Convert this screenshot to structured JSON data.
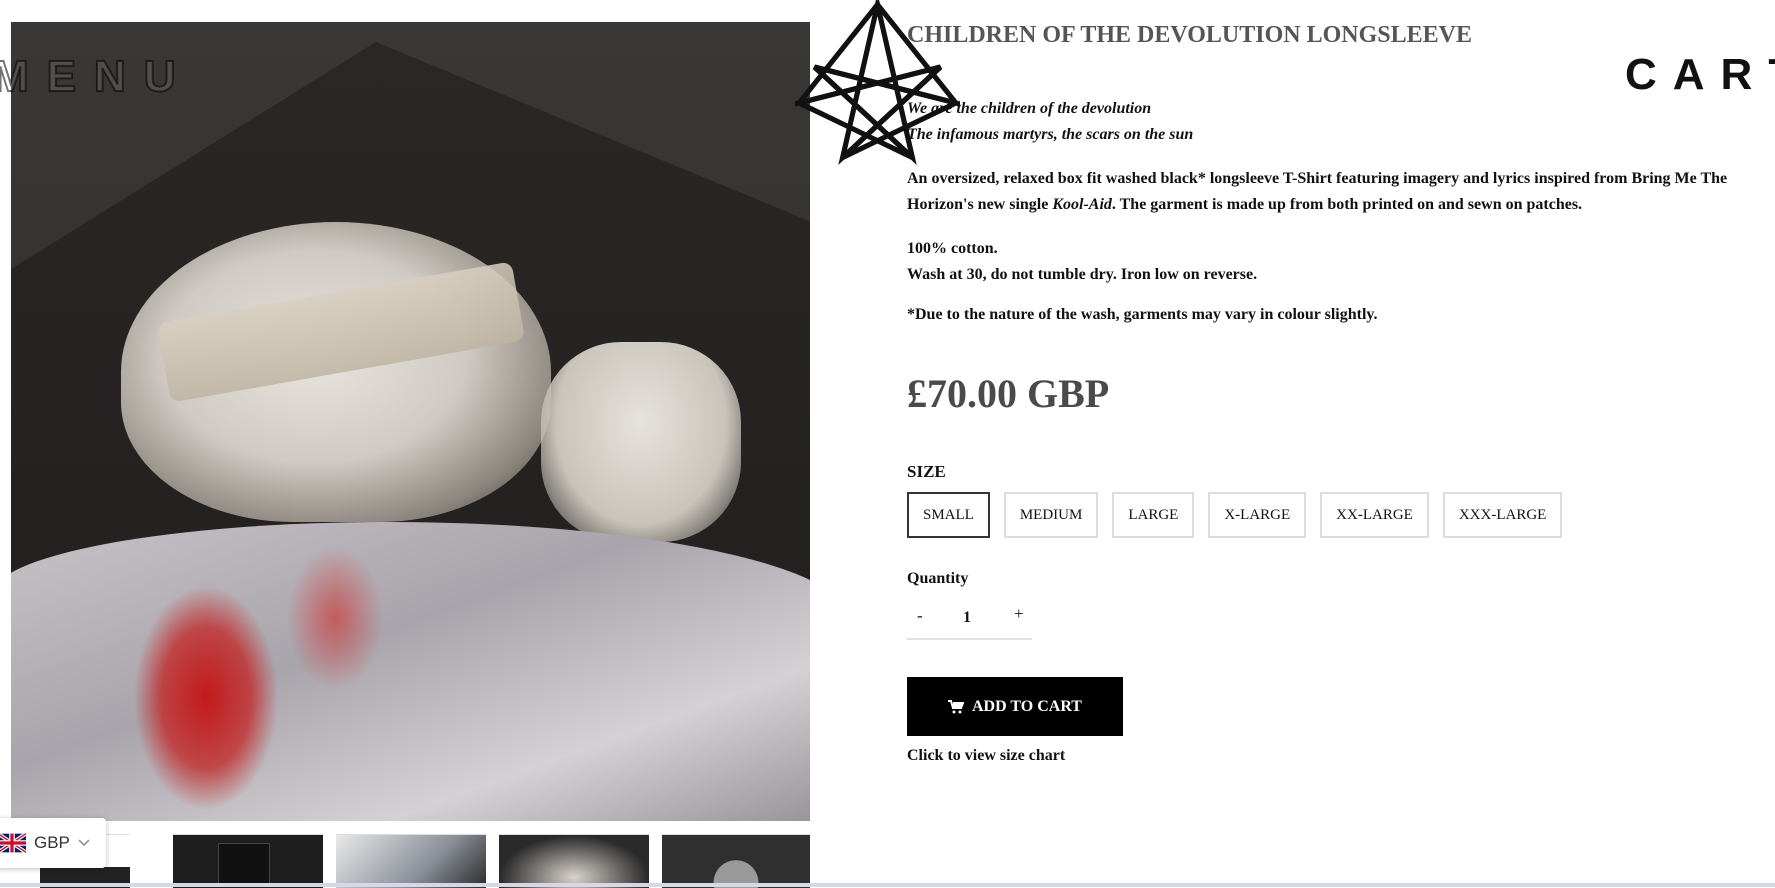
{
  "header": {
    "menu_label": "MENU",
    "cart_label": "CART"
  },
  "product": {
    "title": "CHILDREN OF THE DEVOLUTION LONGSLEEVE",
    "lyrics": [
      "We are the children of the devolution",
      "The infamous martyrs, the scars on the sun"
    ],
    "description_before": "An oversized, relaxed box fit washed black* longsleeve T-Shirt featuring imagery and lyrics inspired from Bring Me The Horizon's new single ",
    "description_emphasis": "Kool-Aid",
    "description_after": ". The garment is made up from both printed on and sewn on patches.",
    "care": [
      "100% cotton.",
      "Wash at 30, do not tumble dry. Iron low on reverse."
    ],
    "note": "*Due to the nature of the wash, garments may vary in colour slightly.",
    "price": "£70.00 GBP"
  },
  "size_selector": {
    "label": "SIZE",
    "options": [
      "SMALL",
      "MEDIUM",
      "LARGE",
      "X-LARGE",
      "XX-LARGE",
      "XXX-LARGE"
    ],
    "selected": "SMALL"
  },
  "quantity": {
    "label": "Quantity",
    "minus": "-",
    "value": "1",
    "plus": "+"
  },
  "actions": {
    "add_to_cart": "ADD TO CART",
    "size_chart": "Click to view size chart"
  },
  "currency": {
    "code": "GBP",
    "flag_icon": "uk-flag-icon",
    "chevron_icon": "chevron-down-icon"
  }
}
